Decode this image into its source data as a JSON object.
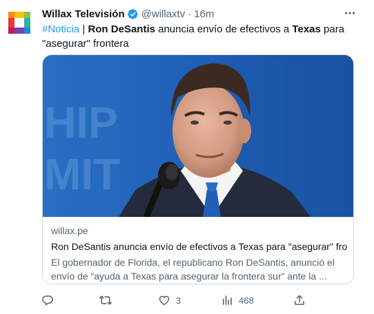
{
  "author": {
    "name": "Willax Televisión",
    "handle": "@willaxtv",
    "separator": "·",
    "time": "16m"
  },
  "tweet": {
    "hashtag": "#Noticia",
    "sep": " | ",
    "bold1": "Ron DeSantis",
    "mid": " anuncia envío de efectivos a ",
    "bold2": "Texas",
    "tail": " para \"asegurar\" frontera"
  },
  "card": {
    "domain": "willax.pe",
    "title": "Ron DeSantis anuncia envío de efectivos a Texas para \"asegurar\" fro...",
    "description": "El gobernador de Florida, el republicano Ron DeSantis, anunció el envío de “ayuda a Texas para asegurar la frontera sur” ante la ..."
  },
  "actions": {
    "reply": {
      "icon": "reply-icon",
      "count": ""
    },
    "retweet": {
      "icon": "retweet-icon",
      "count": ""
    },
    "like": {
      "icon": "heart-icon",
      "count": "3"
    },
    "views": {
      "icon": "views-icon",
      "count": "468"
    },
    "share": {
      "icon": "share-icon",
      "count": ""
    }
  },
  "colors": {
    "accent": "#1d9bf0",
    "muted": "#536471",
    "text": "#0f1419",
    "border": "#cfd9de"
  }
}
